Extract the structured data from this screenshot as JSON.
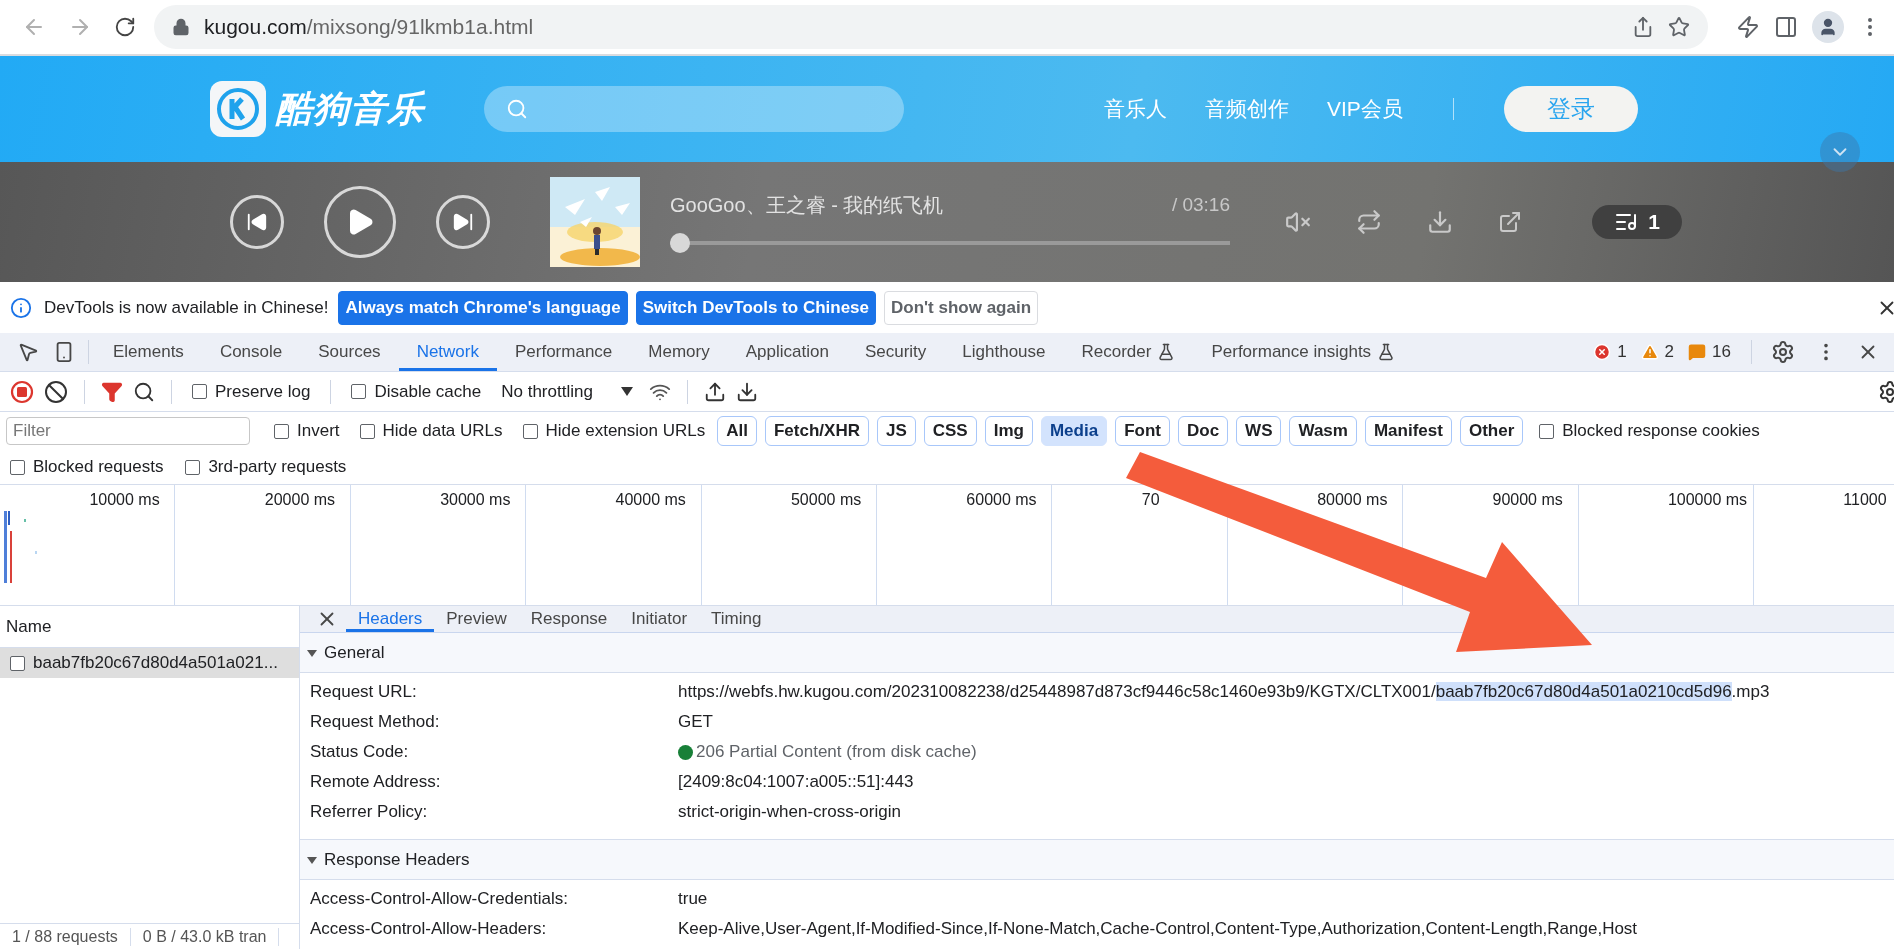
{
  "browser": {
    "nav": [
      {
        "kind": "back",
        "disabled": true
      },
      {
        "kind": "forward",
        "disabled": true
      },
      {
        "kind": "reload",
        "disabled": false
      }
    ],
    "address": {
      "host": "kugou.com",
      "path": "/mixsong/91lkmb1a.html"
    }
  },
  "site": {
    "logo_text": "酷狗音乐",
    "nav": [
      "音乐人",
      "音频创作",
      "VIP会员"
    ],
    "login": "登录"
  },
  "player": {
    "title": "GooGoo、王之睿 - 我的纸飞机",
    "time": "/ 03:16",
    "progress": {
      "level": 0
    },
    "queue_count": "1"
  },
  "devtools": {
    "infobar": {
      "message": "DevTools is now available in Chinese!",
      "buttons": [
        {
          "label": "Always match Chrome's language",
          "kind": "primary"
        },
        {
          "label": "Switch DevTools to Chinese",
          "kind": "primary"
        },
        {
          "label": "Don't show again",
          "kind": "plain"
        }
      ]
    },
    "tabs": [
      {
        "label": "Elements",
        "selected": false,
        "experimental": false
      },
      {
        "label": "Console",
        "selected": false,
        "experimental": false
      },
      {
        "label": "Sources",
        "selected": false,
        "experimental": false
      },
      {
        "label": "Network",
        "selected": true,
        "experimental": false
      },
      {
        "label": "Performance",
        "selected": false,
        "experimental": false
      },
      {
        "label": "Memory",
        "selected": false,
        "experimental": false
      },
      {
        "label": "Application",
        "selected": false,
        "experimental": false
      },
      {
        "label": "Security",
        "selected": false,
        "experimental": false
      },
      {
        "label": "Lighthouse",
        "selected": false,
        "experimental": false
      },
      {
        "label": "Recorder",
        "selected": false,
        "experimental": true
      },
      {
        "label": "Performance insights",
        "selected": false,
        "experimental": true
      }
    ],
    "counts": {
      "errors": "1",
      "warnings": "2",
      "issues": "16"
    },
    "toolbar": {
      "options": [
        {
          "label": "Preserve log",
          "checked": false
        },
        {
          "label": "Disable cache",
          "checked": false
        }
      ],
      "throttling": "No throttling"
    },
    "filter": {
      "placeholder": "Filter",
      "options": [
        {
          "label": "Invert",
          "checked": false
        },
        {
          "label": "Hide data URLs",
          "checked": false
        },
        {
          "label": "Hide extension URLs",
          "checked": false
        }
      ],
      "types": [
        {
          "label": "All",
          "selected": false
        },
        {
          "label": "Fetch/XHR",
          "selected": false
        },
        {
          "label": "JS",
          "selected": false
        },
        {
          "label": "CSS",
          "selected": false
        },
        {
          "label": "Img",
          "selected": false
        },
        {
          "label": "Media",
          "selected": true
        },
        {
          "label": "Font",
          "selected": false
        },
        {
          "label": "Doc",
          "selected": false
        },
        {
          "label": "WS",
          "selected": false
        },
        {
          "label": "Wasm",
          "selected": false
        },
        {
          "label": "Manifest",
          "selected": false
        },
        {
          "label": "Other",
          "selected": false
        }
      ],
      "more_options": [
        {
          "label": "Blocked response cookies",
          "checked": false
        }
      ],
      "second_row": [
        {
          "label": "Blocked requests",
          "checked": false
        },
        {
          "label": "3rd-party requests",
          "checked": false
        }
      ]
    },
    "timeline": {
      "ticks": [
        "10000 ms",
        "20000 ms",
        "30000 ms",
        "40000 ms",
        "50000 ms",
        "60000 ms",
        "70",
        "80000 ms",
        "90000 ms",
        "100000 ms",
        "11000"
      ]
    },
    "requests": {
      "column": "Name",
      "rows": [
        {
          "name": "baab7fb20c67d80d4a501a021...",
          "selected": true,
          "checked": false
        }
      ],
      "status": [
        "1 / 88 requests",
        "0 B / 43.0 kB tran"
      ]
    },
    "details": {
      "tabs": [
        {
          "label": "Headers",
          "selected": true
        },
        {
          "label": "Preview",
          "selected": false
        },
        {
          "label": "Response",
          "selected": false
        },
        {
          "label": "Initiator",
          "selected": false
        },
        {
          "label": "Timing",
          "selected": false
        }
      ],
      "sections": [
        {
          "title": "General",
          "expanded": true,
          "rows": [
            {
              "kind": "parts",
              "name": "Request URL:",
              "value_parts": [
                {
                  "text": "https://webfs.hw.kugou.com/202310082238/d25448987d873cf9446c58c1460e93b9/KGTX/CLTX001/",
                  "selected": false
                },
                {
                  "text": "baab7fb20c67d80d4a501a0210cd5d96",
                  "selected": true
                },
                {
                  "text": ".mp3",
                  "selected": false
                }
              ]
            },
            {
              "kind": "text",
              "name": "Request Method:",
              "value": "GET"
            },
            {
              "kind": "status",
              "name": "Status Code:",
              "value": "206 Partial Content (from disk cache)"
            },
            {
              "kind": "text",
              "name": "Remote Address:",
              "value": "[2409:8c04:1007:a005::51]:443"
            },
            {
              "kind": "text",
              "name": "Referrer Policy:",
              "value": "strict-origin-when-cross-origin"
            }
          ]
        },
        {
          "title": "Response Headers",
          "expanded": true,
          "rows": [
            {
              "kind": "text",
              "name": "Access-Control-Allow-Credentials:",
              "value": "true"
            },
            {
              "kind": "text",
              "name": "Access-Control-Allow-Headers:",
              "value": "Keep-Alive,User-Agent,If-Modified-Since,If-None-Match,Cache-Control,Content-Type,Authorization,Content-Length,Range,Host"
            }
          ]
        }
      ]
    }
  }
}
